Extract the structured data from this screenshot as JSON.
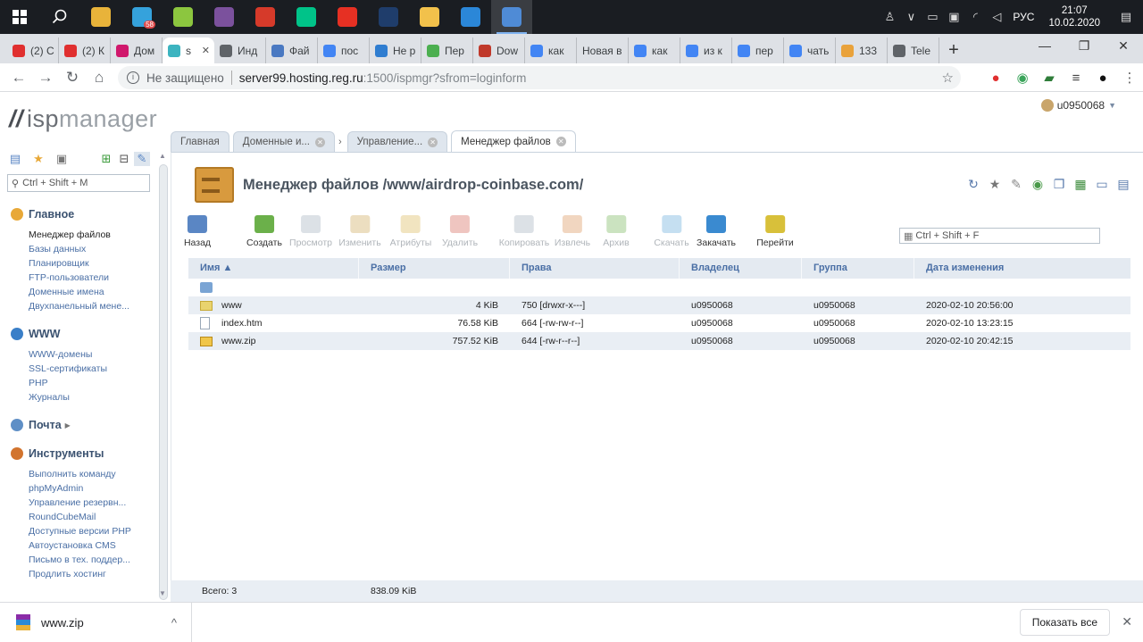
{
  "taskbar": {
    "apps": [
      {
        "name": "chrome-icon",
        "color": "#e8b33a"
      },
      {
        "name": "telegram-icon",
        "color": "#35a2dc",
        "badge": "58"
      },
      {
        "name": "evernote-icon",
        "color": "#8cc63f"
      },
      {
        "name": "viber-icon",
        "color": "#7b519d"
      },
      {
        "name": "filezilla-icon",
        "color": "#d63a2a"
      },
      {
        "name": "audition-icon",
        "color": "#00c389"
      },
      {
        "name": "yandex-icon",
        "color": "#e63023"
      },
      {
        "name": "photoshop-icon",
        "color": "#1f3d6b"
      },
      {
        "name": "explorer-icon",
        "color": "#f2c14b"
      },
      {
        "name": "vscode-icon",
        "color": "#2b87d8"
      },
      {
        "name": "chrome-active-icon",
        "color": "#4f8bd6"
      }
    ],
    "lang": "РУС",
    "time": "21:07",
    "date": "10.02.2020"
  },
  "browser": {
    "tabs": [
      {
        "label": "(2) С",
        "color": "#e02f2f"
      },
      {
        "label": "(2) К",
        "color": "#e02f2f"
      },
      {
        "label": "Дом",
        "color": "#d0186c"
      },
      {
        "label": "s",
        "color": "#3cb4c0",
        "active": true
      },
      {
        "label": "Инд",
        "color": "#5f6368"
      },
      {
        "label": "Фай",
        "color": "#4a79c2"
      },
      {
        "label": "пос",
        "color": "#4285f4"
      },
      {
        "label": "Не р",
        "color": "#2f7dd0"
      },
      {
        "label": "Пер",
        "color": "#4caf50"
      },
      {
        "label": "Dow",
        "color": "#c0392b"
      },
      {
        "label": "как",
        "color": "#4285f4"
      },
      {
        "label": "Новая в",
        "color": ""
      },
      {
        "label": "как",
        "color": "#4285f4"
      },
      {
        "label": "из к",
        "color": "#4285f4"
      },
      {
        "label": "пер",
        "color": "#4285f4"
      },
      {
        "label": "чать",
        "color": "#4285f4"
      },
      {
        "label": "133",
        "color": "#e9a23b"
      },
      {
        "label": "Tele",
        "color": "#5f6368"
      }
    ],
    "new_tab": "+",
    "security_label": "Не защищено",
    "url_host": "server99.hosting.reg.ru",
    "url_path": ":1500/ispmgr?sfrom=loginform"
  },
  "isp": {
    "logo_isp": "isp",
    "logo_mgr": "manager",
    "user": "u0950068",
    "tabs": [
      {
        "label": "Главная"
      },
      {
        "label": "Доменные и..."
      },
      {
        "label": "Управление..."
      },
      {
        "label": "Менеджер файлов"
      }
    ],
    "sidebar": {
      "search_placeholder": "Ctrl + Shift + M",
      "groups": [
        {
          "title": "Главное",
          "color": "#e8a838",
          "items": [
            "Менеджер файлов",
            "Базы данных",
            "Планировщик",
            "FTP-пользователи",
            "Доменные имена",
            "Двухпанельный мене..."
          ]
        },
        {
          "title": "WWW",
          "color": "#3a7fc8",
          "items": [
            "WWW-домены",
            "SSL-сертификаты",
            "PHP",
            "Журналы"
          ]
        },
        {
          "title": "Почта",
          "color": "#5f8fc6",
          "items": []
        },
        {
          "title": "Инструменты",
          "color": "#d2742e",
          "items": [
            "Выполнить команду",
            "phpMyAdmin",
            "Управление резервн...",
            "RoundCubeMail",
            "Доступные версии PHP",
            "Автоустановка CMS",
            "Письмо в тех. поддер...",
            "Продлить хостинг"
          ]
        }
      ]
    },
    "page_title": "Менеджер файлов /www/airdrop-coinbase.com/",
    "toolbar": [
      {
        "label": "Назад",
        "color": "#5a86c4",
        "enabled": true
      },
      {
        "label": "Создать",
        "color": "#6bb04a",
        "enabled": true
      },
      {
        "label": "Просмотр",
        "color": "#9aa8b8",
        "enabled": false
      },
      {
        "label": "Изменить",
        "color": "#c8a14a",
        "enabled": false
      },
      {
        "label": "Атрибуты",
        "color": "#d8b24a",
        "enabled": false
      },
      {
        "label": "Удалить",
        "color": "#d05a4a",
        "enabled": false
      },
      {
        "label": "Копировать",
        "color": "#9aa8b8",
        "enabled": false
      },
      {
        "label": "Извлечь",
        "color": "#d88a4a",
        "enabled": false
      },
      {
        "label": "Архив",
        "color": "#6bb04a",
        "enabled": false
      },
      {
        "label": "Скачать",
        "color": "#5aa4d8",
        "enabled": false
      },
      {
        "label": "Закачать",
        "color": "#3a8ad0",
        "enabled": true
      },
      {
        "label": "Перейти",
        "color": "#d8c03a",
        "enabled": true
      }
    ],
    "table_search_placeholder": "Ctrl + Shift + F",
    "columns": [
      "Имя ▲",
      "Размер",
      "Права",
      "Владелец",
      "Группа",
      "Дата изменения"
    ],
    "rows": [
      {
        "type": "folder",
        "name": "www",
        "size": "4 KiB",
        "perm": "750 [drwxr-x---]",
        "owner": "u0950068",
        "group": "u0950068",
        "date": "2020-02-10 20:56:00"
      },
      {
        "type": "file",
        "name": "index.htm",
        "size": "76.58 KiB",
        "perm": "664 [-rw-rw-r--]",
        "owner": "u0950068",
        "group": "u0950068",
        "date": "2020-02-10 13:23:15"
      },
      {
        "type": "zip",
        "name": "www.zip",
        "size": "757.52 KiB",
        "perm": "644 [-rw-r--r--]",
        "owner": "u0950068",
        "group": "u0950068",
        "date": "2020-02-10 20:42:15"
      }
    ],
    "footer_total": "Всего: 3",
    "footer_size": "838.09 KiB"
  },
  "downloads": {
    "file": "www.zip",
    "show_all": "Показать все"
  }
}
